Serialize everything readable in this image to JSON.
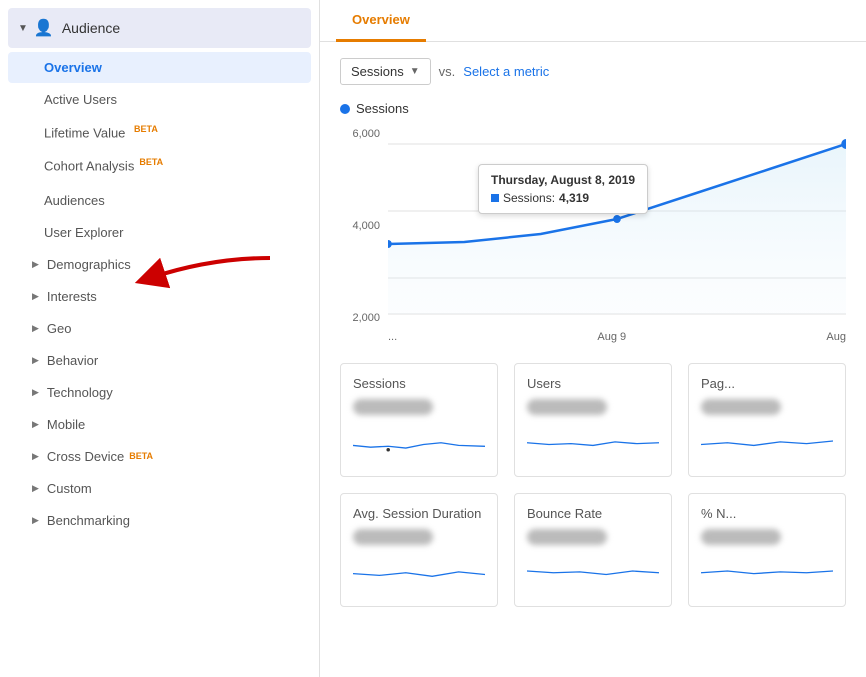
{
  "sidebar": {
    "audience_label": "Audience",
    "collapse_arrow": "▼",
    "items": [
      {
        "id": "overview",
        "label": "Overview",
        "active": true,
        "indent": "deep",
        "type": "plain"
      },
      {
        "id": "active-users",
        "label": "Active Users",
        "active": false,
        "type": "plain"
      },
      {
        "id": "lifetime-value",
        "label": "Lifetime Value",
        "active": false,
        "type": "plain",
        "badge": "BETA"
      },
      {
        "id": "cohort-analysis",
        "label": "Cohort Analysis",
        "active": false,
        "type": "plain",
        "badge": "BETA",
        "badge_below": true
      },
      {
        "id": "audiences",
        "label": "Audiences",
        "active": false,
        "type": "plain"
      },
      {
        "id": "user-explorer",
        "label": "User Explorer",
        "active": false,
        "type": "plain"
      },
      {
        "id": "demographics",
        "label": "Demographics",
        "active": false,
        "type": "expandable"
      },
      {
        "id": "interests",
        "label": "Interests",
        "active": false,
        "type": "expandable"
      },
      {
        "id": "geo",
        "label": "Geo",
        "active": false,
        "type": "expandable"
      },
      {
        "id": "behavior",
        "label": "Behavior",
        "active": false,
        "type": "expandable"
      },
      {
        "id": "technology",
        "label": "Technology",
        "active": false,
        "type": "expandable"
      },
      {
        "id": "mobile",
        "label": "Mobile",
        "active": false,
        "type": "expandable"
      },
      {
        "id": "cross-device",
        "label": "Cross Device",
        "active": false,
        "type": "expandable",
        "badge": "BETA"
      },
      {
        "id": "custom",
        "label": "Custom",
        "active": false,
        "type": "expandable"
      },
      {
        "id": "benchmarking",
        "label": "Benchmarking",
        "active": false,
        "type": "expandable"
      }
    ]
  },
  "tabs": [
    {
      "id": "overview",
      "label": "Overview",
      "active": true
    }
  ],
  "metric_selector": {
    "selected": "Sessions",
    "vs_text": "vs.",
    "select_metric_label": "Select a metric"
  },
  "chart": {
    "sessions_label": "Sessions",
    "y_labels": [
      "6,000",
      "4,000",
      "2,000"
    ],
    "x_labels": [
      "...",
      "Aug 9",
      "Aug"
    ],
    "tooltip": {
      "date": "Thursday, August 8, 2019",
      "metric_label": "Sessions:",
      "metric_value": "4,319"
    }
  },
  "mini_charts": [
    {
      "id": "sessions",
      "title": "Sessions"
    },
    {
      "id": "users",
      "title": "Users"
    },
    {
      "id": "pageviews",
      "title": "Pag..."
    },
    {
      "id": "avg-session-duration",
      "title": "Avg. Session Duration"
    },
    {
      "id": "bounce-rate",
      "title": "Bounce Rate"
    },
    {
      "id": "percent-new",
      "title": "% N..."
    }
  ],
  "colors": {
    "active_nav_bg": "#e8f0fe",
    "active_nav_text": "#1a73e8",
    "active_tab_text": "#e67c00",
    "beta_badge": "#e67c00",
    "chart_line": "#1a73e8",
    "chart_fill": "#e8f4fd"
  }
}
